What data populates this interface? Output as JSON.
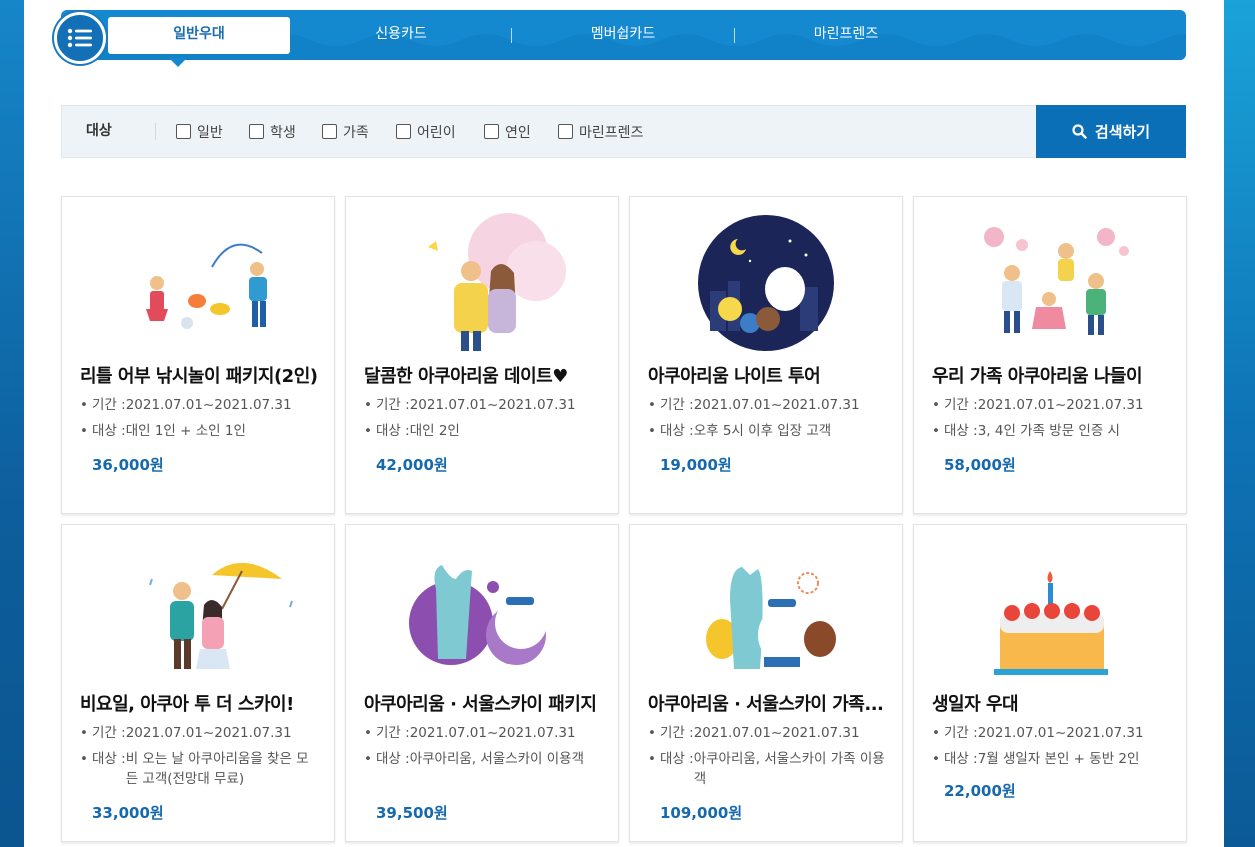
{
  "tabs": [
    {
      "label": "일반우대",
      "active": true
    },
    {
      "label": "신용카드",
      "active": false
    },
    {
      "label": "멤버쉽카드",
      "active": false
    },
    {
      "label": "마린프렌즈",
      "active": false
    }
  ],
  "menu_icon": "list-menu-icon",
  "filter": {
    "label": "대상",
    "options": [
      "일반",
      "학생",
      "가족",
      "어린이",
      "연인",
      "마린프렌즈"
    ],
    "search_label": "검색하기"
  },
  "cards": [
    {
      "title": "리틀 어부 낚시놀이 패키지(2인)",
      "period_key": "기간 : ",
      "period": "2021.07.01~2021.07.31",
      "target_key": "대상 : ",
      "target": "대인 1인 + 소인 1인",
      "price": "36,000원"
    },
    {
      "title": "달콤한 아쿠아리움 데이트♥",
      "period_key": "기간 : ",
      "period": "2021.07.01~2021.07.31",
      "target_key": "대상 : ",
      "target": "대인 2인",
      "price": "42,000원"
    },
    {
      "title": "아쿠아리움 나이트 투어",
      "period_key": "기간 : ",
      "period": "2021.07.01~2021.07.31",
      "target_key": "대상 : ",
      "target": "오후 5시 이후 입장 고객",
      "price": "19,000원"
    },
    {
      "title": "우리 가족 아쿠아리움 나들이",
      "period_key": "기간 : ",
      "period": "2021.07.01~2021.07.31",
      "target_key": "대상 : ",
      "target": "3, 4인 가족 방문 인증 시",
      "price": "58,000원"
    },
    {
      "title": "비요일, 아쿠아 투 더 스카이!",
      "period_key": "기간 : ",
      "period": "2021.07.01~2021.07.31",
      "target_key": "대상 : ",
      "target": "비 오는 날 아쿠아리움을 찾은 모든 고객(전망대 무료)",
      "price": "33,000원"
    },
    {
      "title": "아쿠아리움 · 서울스카이 패키지",
      "period_key": "기간 : ",
      "period": "2021.07.01~2021.07.31",
      "target_key": "대상 : ",
      "target": "아쿠아리움, 서울스카이 이용객",
      "price": "39,500원"
    },
    {
      "title": "아쿠아리움 · 서울스카이 가족...",
      "period_key": "기간 : ",
      "period": "2021.07.01~2021.07.31",
      "target_key": "대상 : ",
      "target": "아쿠아리움, 서울스카이 가족 이용객",
      "price": "109,000원"
    },
    {
      "title": "생일자 우대",
      "period_key": "기간 : ",
      "period": "2021.07.01~2021.07.31",
      "target_key": "대상 : ",
      "target": "7월 생일자 본인 + 동반 2인",
      "price": "22,000원"
    }
  ]
}
